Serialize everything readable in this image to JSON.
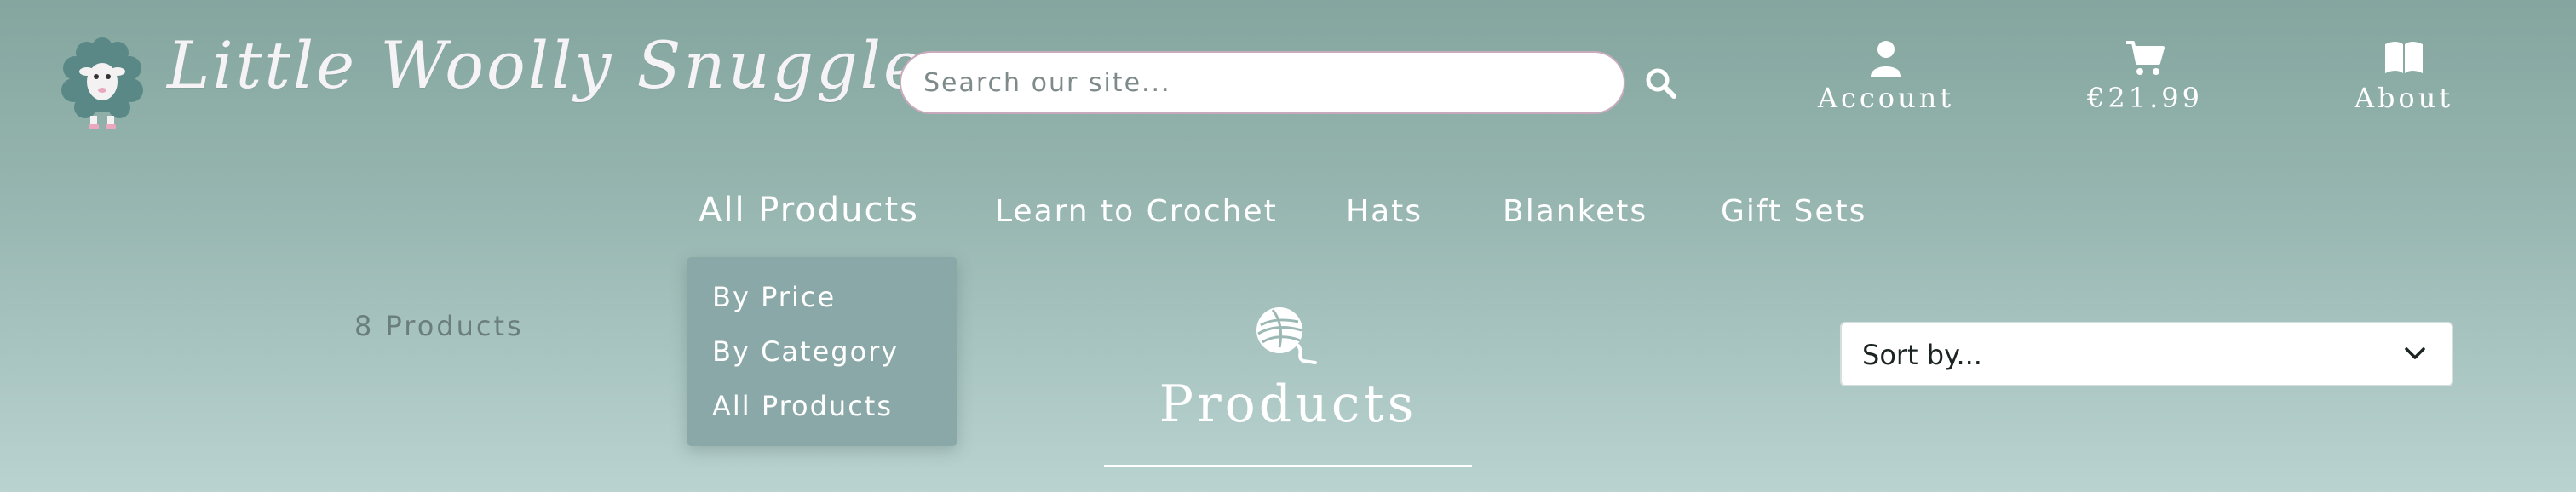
{
  "brand": {
    "name": "Little Woolly Snuggles",
    "logo_icon": "sheep-logo-icon"
  },
  "search": {
    "placeholder": "Search our site...",
    "value": "",
    "icon": "search-icon"
  },
  "top_links": [
    {
      "label": "Account",
      "icon": "user-icon"
    },
    {
      "label": "€21.99",
      "icon": "cart-icon"
    },
    {
      "label": "About",
      "icon": "book-icon"
    }
  ],
  "nav": {
    "items": [
      {
        "label": "All Products",
        "active": true
      },
      {
        "label": "Learn to Crochet"
      },
      {
        "label": "Hats"
      },
      {
        "label": "Blankets"
      },
      {
        "label": "Gift Sets"
      }
    ]
  },
  "dropdown": {
    "items": [
      {
        "label": "By Price"
      },
      {
        "label": "By Category"
      },
      {
        "label": "All Products"
      }
    ]
  },
  "listing": {
    "count_text": "8 Products",
    "title": "Products",
    "title_icon": "yarn-ball-icon",
    "sort_label": "Sort by...",
    "sort_icon": "chevron-down-icon"
  },
  "colors": {
    "background_top": "#84a69f",
    "background_bottom": "#b9d3d0",
    "dropdown_bg": "#8aa8a7",
    "search_border": "#c9aabd",
    "text_light": "#ffffff",
    "count_text": "#6a7e7d"
  }
}
